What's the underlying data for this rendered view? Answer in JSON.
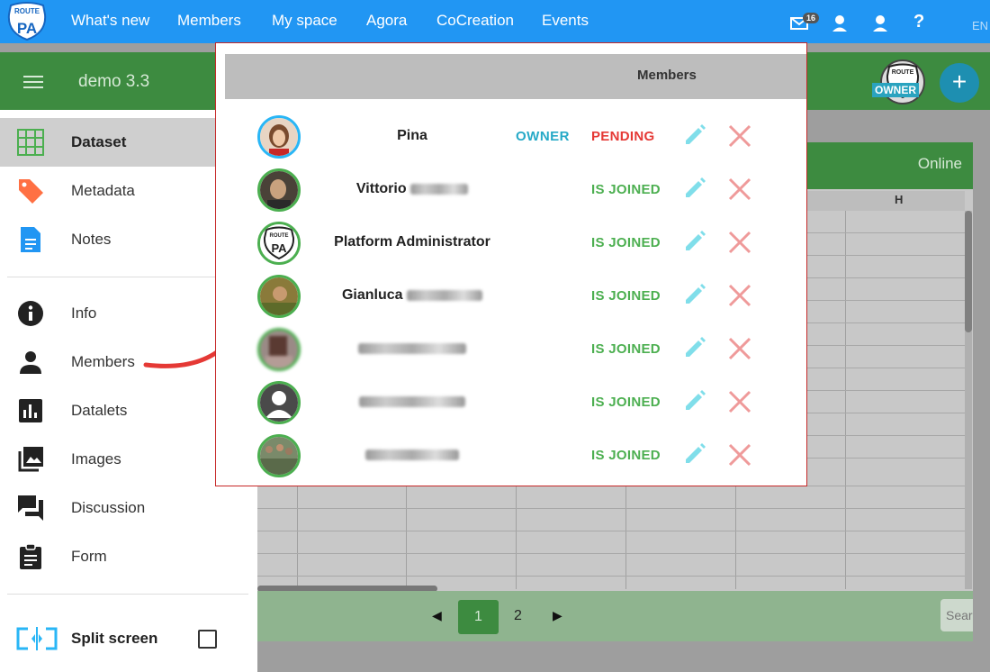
{
  "nav": {
    "logo_text": "ROUTE TO PA",
    "items": [
      "What's new",
      "Members",
      "My space",
      "Agora",
      "CoCreation",
      "Events"
    ],
    "mail_count": "16",
    "help": "?",
    "lang": "EN"
  },
  "toolbar": {
    "title": "demo 3.3",
    "owner_tag": "OWNER",
    "add": "+"
  },
  "sidebar": {
    "items": [
      {
        "label": "Dataset",
        "icon": "grid-icon"
      },
      {
        "label": "Metadata",
        "icon": "tag-icon"
      },
      {
        "label": "Notes",
        "icon": "document-icon"
      },
      {
        "label": "Info",
        "icon": "info-icon"
      },
      {
        "label": "Members",
        "icon": "person-icon"
      },
      {
        "label": "Datalets",
        "icon": "bar-chart-icon"
      },
      {
        "label": "Images",
        "icon": "images-icon"
      },
      {
        "label": "Discussion",
        "icon": "chat-icon"
      },
      {
        "label": "Form",
        "icon": "clipboard-icon"
      }
    ],
    "split_screen": "Split screen"
  },
  "sheet": {
    "status": "Online",
    "column_h": "H",
    "pager": {
      "prev": "◀",
      "pages": [
        "1",
        "2"
      ],
      "next": "▶",
      "search_placeholder": "Search"
    }
  },
  "modal": {
    "title": "Members",
    "members": [
      {
        "name": "Pina",
        "role": "OWNER",
        "status": "PENDING"
      },
      {
        "name": "Vittorio",
        "role": "",
        "status": "IS JOINED"
      },
      {
        "name": "Platform Administrator",
        "role": "",
        "status": "IS JOINED"
      },
      {
        "name": "Gianluca",
        "role": "",
        "status": "IS JOINED"
      },
      {
        "name": "",
        "role": "",
        "status": "IS JOINED"
      },
      {
        "name": "",
        "role": "",
        "status": "IS JOINED"
      },
      {
        "name": "",
        "role": "",
        "status": "IS JOINED"
      }
    ]
  },
  "colors": {
    "nav": "#2196f3",
    "toolbar": "#3d8b40",
    "owner": "#26a9c7",
    "joined": "#4caf50",
    "pending": "#e53935",
    "modal_border": "#c62828"
  }
}
